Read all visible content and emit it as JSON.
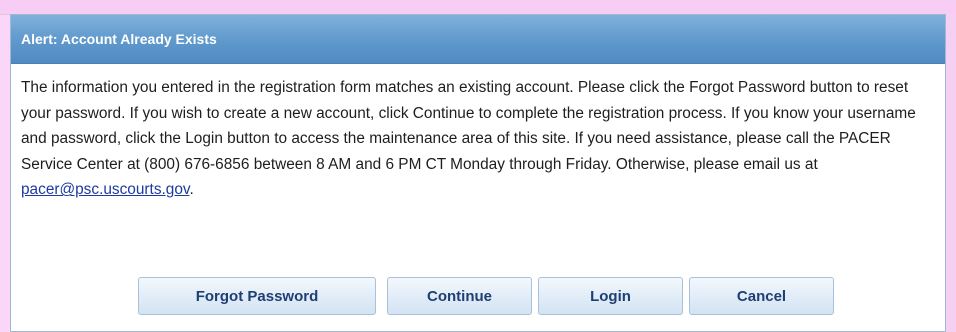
{
  "dialog": {
    "title": "Alert: Account Already Exists",
    "message_before_link": "The information you entered in the registration form matches an existing account. Please click the Forgot Password button to reset your password. If you wish to create a new account, click Continue to complete the registration process. If you know your username and password, click the Login button to access the maintenance area of this site. If you need assistance, please call the PACER Service Center at (800) 676-6856 between 8 AM and 6 PM CT Monday through Friday. Otherwise, please email us at",
    "email_link": "pacer@psc.uscourts.gov",
    "message_after_link": ".",
    "buttons": {
      "forgot_password": "Forgot Password",
      "continue": "Continue",
      "login": "Login",
      "cancel": "Cancel"
    }
  },
  "colors": {
    "backdrop": "#fad6f8",
    "titlebar": "#5f98cc",
    "button_text": "#1f3f74",
    "link": "#1d3aa0"
  }
}
